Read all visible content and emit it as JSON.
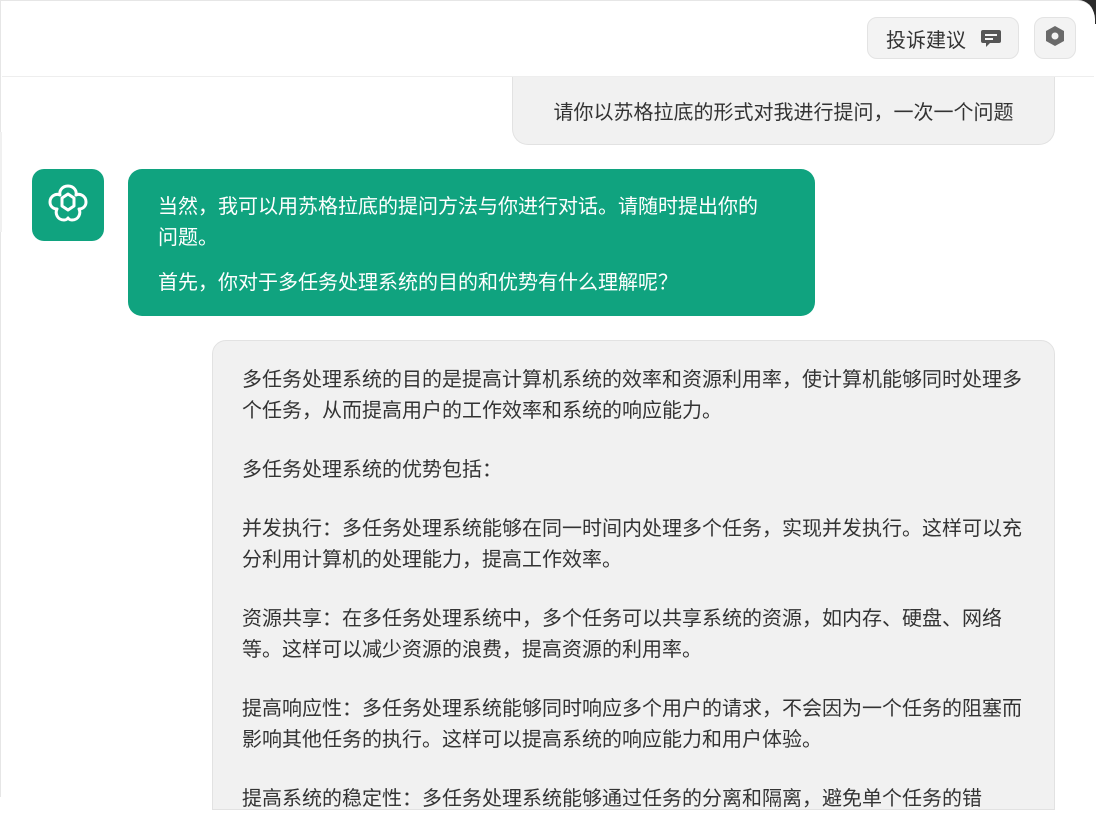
{
  "header": {
    "feedback_label": "投诉建议",
    "feedback_icon": "message-icon",
    "settings_icon": "hexagon-settings-icon"
  },
  "conversation": {
    "user_message": "请你以苏格拉底的形式对我进行提问，一次一个问题",
    "assistant": {
      "avatar_icon": "openai-logo-icon",
      "paragraphs": [
        "当然，我可以用苏格拉底的提问方法与你进行对话。请随时提出你的问题。",
        "首先，你对于多任务处理系统的目的和优势有什么理解呢？"
      ]
    },
    "user_reply": {
      "paragraphs": [
        "多任务处理系统的目的是提高计算机系统的效率和资源利用率，使计算机能够同时处理多个任务，从而提高用户的工作效率和系统的响应能力。",
        "多任务处理系统的优势包括：",
        "并发执行：多任务处理系统能够在同一时间内处理多个任务，实现并发执行。这样可以充分利用计算机的处理能力，提高工作效率。",
        "资源共享：在多任务处理系统中，多个任务可以共享系统的资源，如内存、硬盘、网络等。这样可以减少资源的浪费，提高资源的利用率。",
        "提高响应性：多任务处理系统能够同时响应多个用户的请求，不会因为一个任务的阻塞而影响其他任务的执行。这样可以提高系统的响应能力和用户体验。",
        "提高系统的稳定性：多任务处理系统能够通过任务的分离和隔离，避免单个任务的错"
      ]
    }
  },
  "colors": {
    "accent": "#10a37f",
    "bubble_bg": "#f1f1f1"
  }
}
